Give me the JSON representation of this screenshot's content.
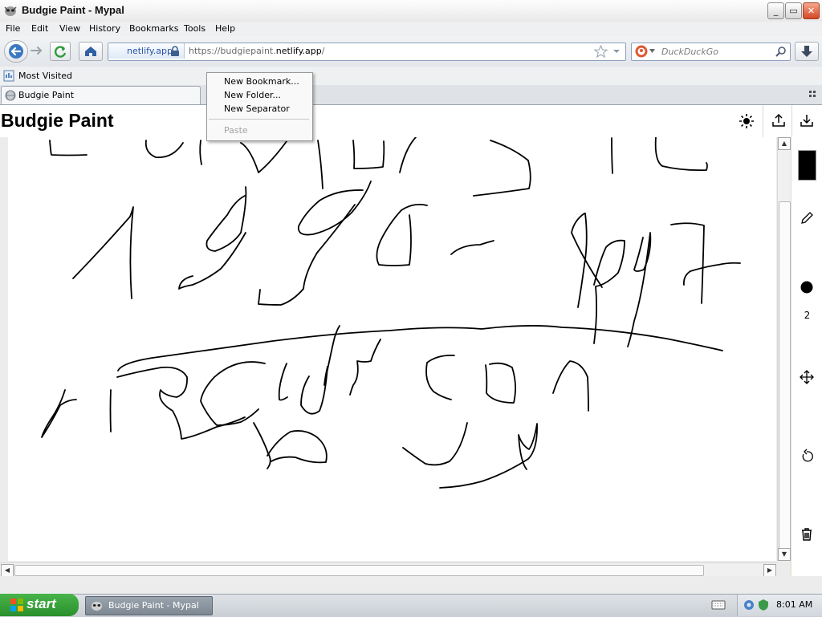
{
  "window": {
    "title": "Budgie Paint - Mypal",
    "controls": {
      "minimize": "_",
      "maximize": "▭",
      "close": "✕"
    }
  },
  "menubar": {
    "items": [
      {
        "label": "File"
      },
      {
        "label": "Edit"
      },
      {
        "label": "View"
      },
      {
        "label": "History"
      },
      {
        "label": "Bookmarks"
      },
      {
        "label": "Tools"
      },
      {
        "label": "Help"
      }
    ]
  },
  "navigation": {
    "identity_label": "netlify.app",
    "url_prefix": "https://budgiepaint.",
    "url_domain": "netlify.app",
    "url_suffix": "/",
    "search_placeholder": "DuckDuckGo"
  },
  "bookmarks_bar": {
    "most_visited": "Most Visited"
  },
  "tabs": [
    {
      "label": "Budgie Paint"
    }
  ],
  "context_menu": {
    "items": [
      {
        "label": "New Bookmark...",
        "enabled": true
      },
      {
        "label": "New Folder...",
        "enabled": true
      },
      {
        "label": "New Separator",
        "enabled": true
      },
      {
        "label": "Paste",
        "enabled": false
      }
    ]
  },
  "app": {
    "title": "Budgie Paint",
    "toolbar": {
      "current_color": "#000000",
      "brush_size": "2",
      "tools": [
        "color-swatch",
        "pencil-icon",
        "brush-size-dot",
        "move-icon",
        "undo-icon",
        "trash-icon"
      ]
    },
    "header_actions": [
      "theme-sun-icon",
      "upload-icon",
      "download-icon"
    ]
  },
  "taskbar": {
    "start_label": "start",
    "task_label": "Budgie Paint - Mypal",
    "clock": "8:01 AM"
  }
}
